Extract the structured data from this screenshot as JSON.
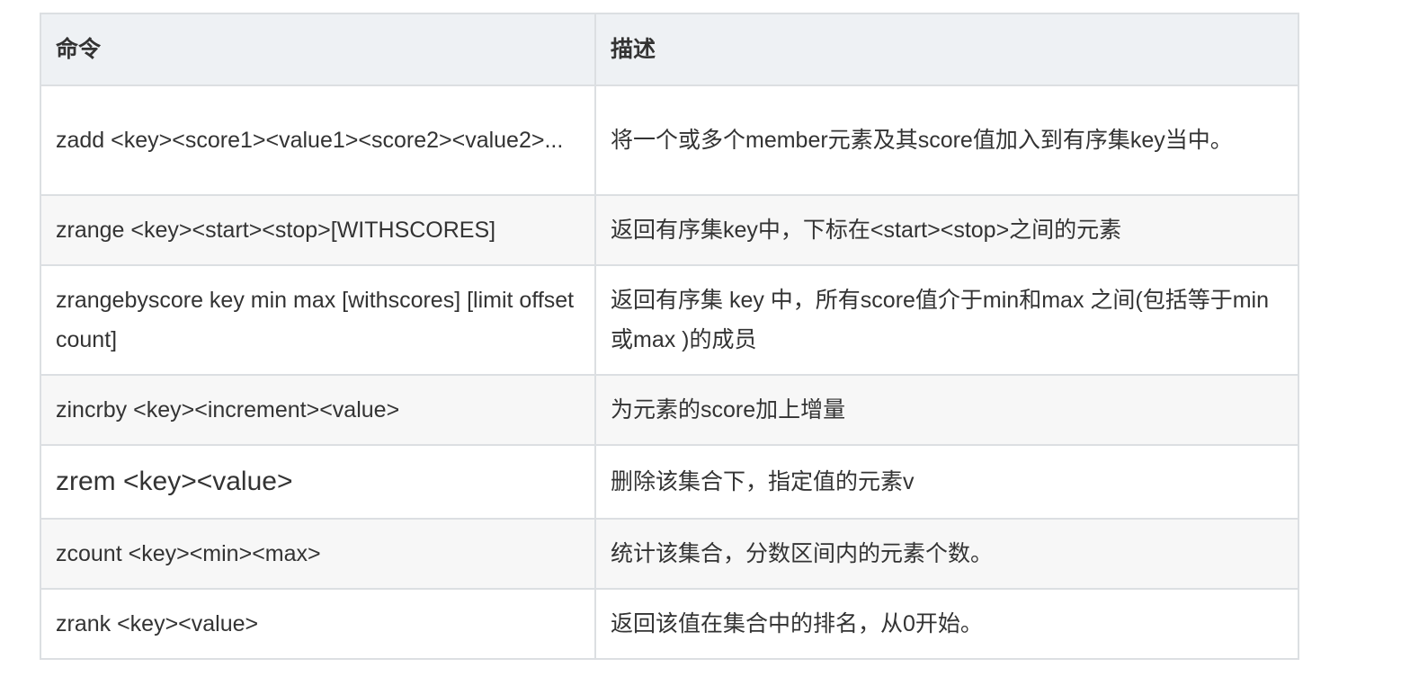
{
  "table": {
    "headers": [
      "命令",
      "描述"
    ],
    "rows": [
      {
        "command": "zadd <key><score1><value1><score2><value2>...",
        "description": " 将一个或多个member元素及其score值加入到有序集key当中。"
      },
      {
        "command": "zrange <key><start><stop>[WITHSCORES]",
        "description": " 返回有序集key中，下标在<start><stop>之间的元素"
      },
      {
        "command": "zrangebyscore key min max [withscores] [limit offset count]",
        "description": "返回有序集 key 中，所有score值介于min和max 之间(包括等于min或max )的成员"
      },
      {
        "command": "zincrby <key><increment><value>",
        "description": "为元素的score加上增量"
      },
      {
        "command": "zrem <key><value>",
        "description": "删除该集合下，指定值的元素v"
      },
      {
        "command": "zcount <key><min><max>",
        "description": "统计该集合，分数区间内的元素个数。"
      },
      {
        "command": "zrank <key><value>",
        "description": "返回该值在集合中的排名，从0开始。"
      }
    ]
  }
}
